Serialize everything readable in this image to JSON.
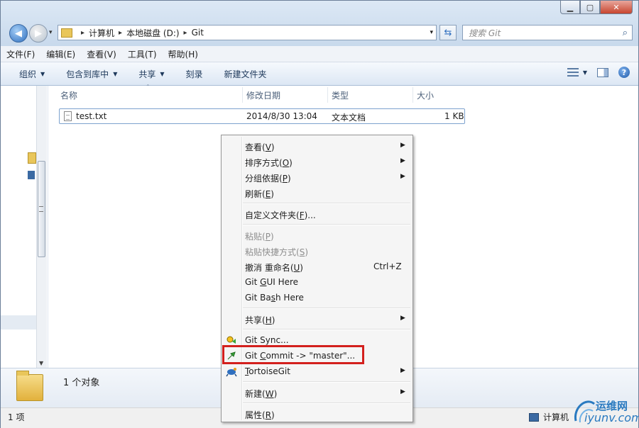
{
  "window": {
    "controls": {
      "minimize": "▁",
      "maximize": "▢",
      "close": "✕"
    }
  },
  "nav": {
    "back_glyph": "◀",
    "forward_glyph": "▶",
    "dropdown_glyph": "▾",
    "address": [
      "计算机",
      "本地磁盘 (D:)",
      "Git"
    ],
    "address_sep": "▸",
    "address_dropdown": "▾",
    "refresh_glyph": "⇆",
    "search_placeholder": "搜索 Git",
    "search_icon": "⌕"
  },
  "menubar": [
    "文件(F)",
    "编辑(E)",
    "查看(V)",
    "工具(T)",
    "帮助(H)"
  ],
  "toolbar": {
    "items": [
      {
        "label": "组织",
        "arrow": "▼"
      },
      {
        "label": "包含到库中",
        "arrow": "▼"
      },
      {
        "label": "共享",
        "arrow": "▼"
      },
      {
        "label": "刻录",
        "arrow": ""
      },
      {
        "label": "新建文件夹",
        "arrow": ""
      }
    ],
    "views_arrow": "▼",
    "help": "?"
  },
  "columns": {
    "name": "名称",
    "modified": "修改日期",
    "type": "类型",
    "size": "大小",
    "sort_glyph": "⌃"
  },
  "files": [
    {
      "name": "test.txt",
      "modified": "2014/8/30 13:04",
      "type": "文本文档",
      "size": "1 KB"
    }
  ],
  "details": {
    "count": "1 个对象"
  },
  "status": {
    "items": "1 项",
    "location": "计算机"
  },
  "watermark": {
    "cn": "运维网",
    "en": "iyunv.com"
  },
  "context_menu": {
    "submenu_glyph": "▶",
    "items": [
      {
        "pre": "查看(",
        "key": "V",
        "post": ")",
        "submenu": true
      },
      {
        "pre": "排序方式(",
        "key": "O",
        "post": ")",
        "submenu": true
      },
      {
        "pre": "分组依据(",
        "key": "P",
        "post": ")",
        "submenu": true
      },
      {
        "pre": "刷新(",
        "key": "E",
        "post": ")"
      },
      {
        "pre": "自定义文件夹(",
        "key": "F",
        "post": ")..."
      },
      {
        "pre": "粘贴(",
        "key": "P",
        "post": ")",
        "disabled": true
      },
      {
        "pre": "粘贴快捷方式(",
        "key": "S",
        "post": ")",
        "disabled": true
      },
      {
        "pre": "撤消 重命名(",
        "key": "U",
        "post": ")",
        "shortcut": "Ctrl+Z"
      },
      {
        "pre": "Git ",
        "key": "G",
        "post": "UI Here"
      },
      {
        "pre": "Git Ba",
        "key": "s",
        "post": "h Here"
      },
      {
        "pre": "共享(",
        "key": "H",
        "post": ")",
        "submenu": true
      },
      {
        "pre": "Git Sync...",
        "key": "",
        "post": ""
      },
      {
        "pre": "Git ",
        "key": "C",
        "post": "ommit -> \"master\"..."
      },
      {
        "pre": "",
        "key": "T",
        "post": "ortoiseGit",
        "submenu": true
      },
      {
        "pre": "新建(",
        "key": "W",
        "post": ")",
        "submenu": true
      },
      {
        "pre": "属性(",
        "key": "R",
        "post": ")"
      }
    ]
  },
  "colors": {
    "highlight_box": "#d3201d",
    "accent": "#2f6fbf"
  }
}
